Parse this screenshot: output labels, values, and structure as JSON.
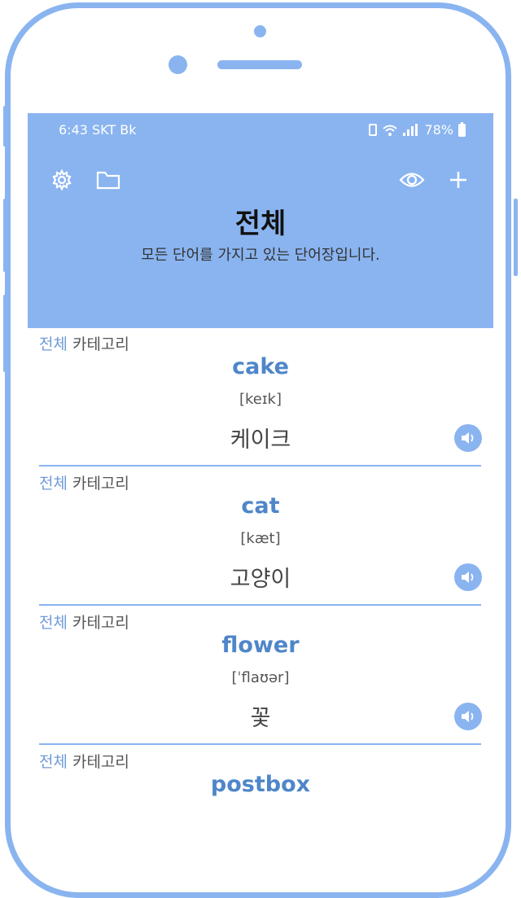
{
  "status": {
    "time": "6:43 SKT Bk",
    "battery": "78%"
  },
  "header": {
    "title": "전체",
    "subtitle": "모든 단어를 가지고 있는 단어장입니다."
  },
  "words": [
    {
      "category_all": "전체",
      "category_label": "카테고리",
      "word": "cake",
      "phonetic": "[keɪk]",
      "meaning": "케이크"
    },
    {
      "category_all": "전체",
      "category_label": "카테고리",
      "word": "cat",
      "phonetic": "[kæt]",
      "meaning": "고양이"
    },
    {
      "category_all": "전체",
      "category_label": "카테고리",
      "word": "flower",
      "phonetic": "[ˈflaʊər]",
      "meaning": "꽃"
    },
    {
      "category_all": "전체",
      "category_label": "카테고리",
      "word": "postbox",
      "phonetic": "",
      "meaning": ""
    }
  ],
  "colors": {
    "accent": "#8ab4f0",
    "word": "#4f86c9"
  }
}
